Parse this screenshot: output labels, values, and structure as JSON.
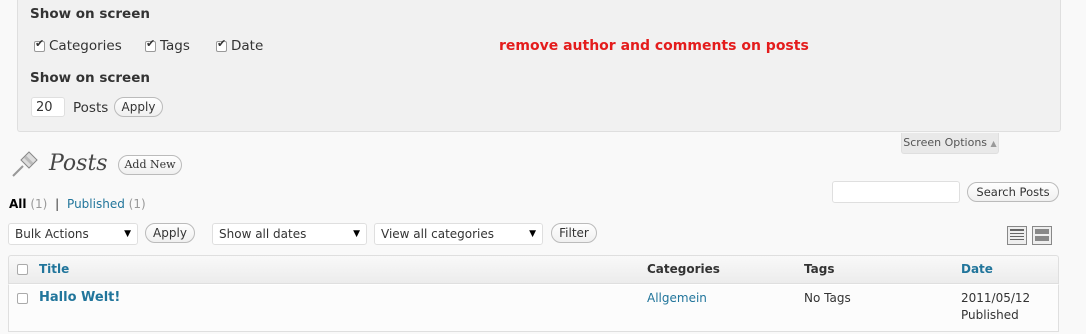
{
  "screen_options": {
    "heading1": "Show on screen",
    "columns": [
      {
        "label": "Categories",
        "checked": true
      },
      {
        "label": "Tags",
        "checked": true
      },
      {
        "label": "Date",
        "checked": true
      }
    ],
    "note": "remove author and comments on posts",
    "heading2": "Show on screen",
    "per_page_value": "20",
    "per_page_label": "Posts",
    "apply_label": "Apply",
    "tab_label": "Screen Options"
  },
  "header": {
    "title": "Posts",
    "add_new_label": "Add New"
  },
  "filters": {
    "all_label": "All",
    "all_count": "(1)",
    "separator": "|",
    "published_label": "Published",
    "published_count": "(1)"
  },
  "search": {
    "button_label": "Search Posts",
    "value": ""
  },
  "tablenav": {
    "bulk_actions": "Bulk Actions",
    "apply_label": "Apply",
    "dates": "Show all dates",
    "categories": "View all categories",
    "filter_label": "Filter"
  },
  "table": {
    "columns": {
      "title": "Title",
      "categories": "Categories",
      "tags": "Tags",
      "date": "Date"
    },
    "rows": [
      {
        "title": "Hallo Welt!",
        "category": "Allgemein",
        "tags": "No Tags",
        "date": "2011/05/12",
        "status": "Published"
      }
    ]
  },
  "colors": {
    "link": "#21759b",
    "note": "#e41c1c",
    "panel_bg": "#f1f1f1"
  }
}
